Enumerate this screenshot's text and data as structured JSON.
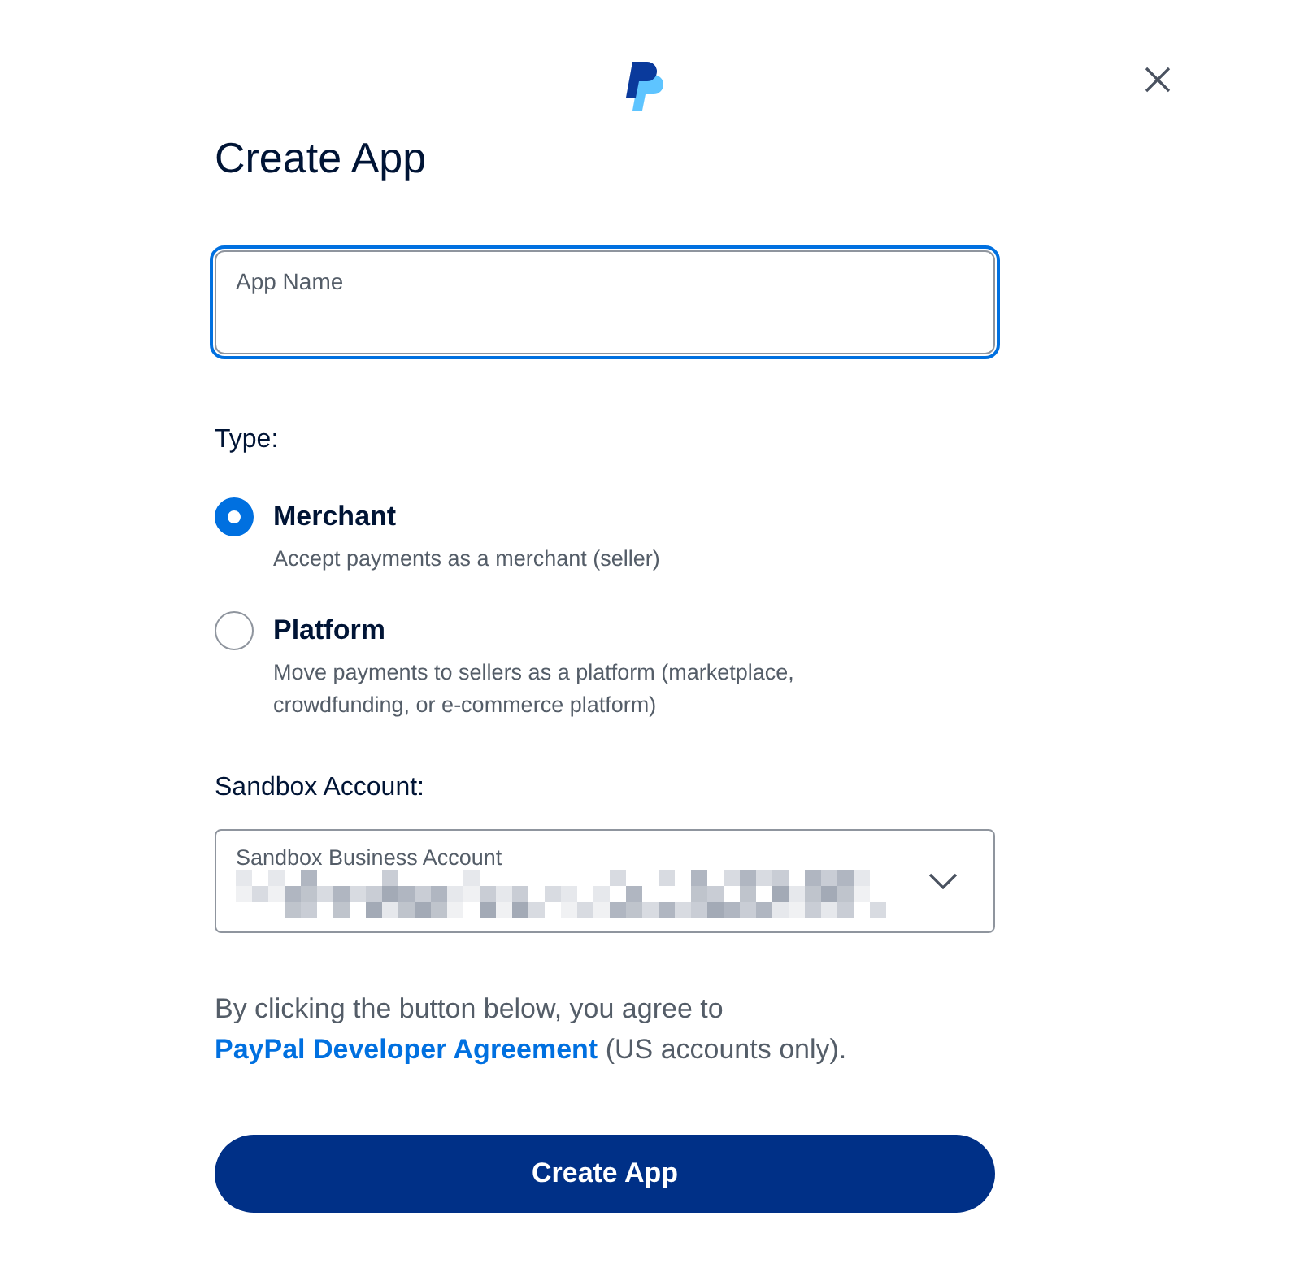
{
  "title": "Create App",
  "app_name_field": {
    "placeholder": "App Name",
    "focused": true
  },
  "type_label": "Type:",
  "types": [
    {
      "label": "Merchant",
      "description": "Accept payments as a merchant (seller)",
      "selected": true
    },
    {
      "label": "Platform",
      "description": "Move payments to sellers as a platform (marketplace, crowdfunding, or e-commerce platform)",
      "selected": false
    }
  ],
  "sandbox_label": "Sandbox Account:",
  "sandbox_select": {
    "label": "Sandbox Business Account"
  },
  "agreement": {
    "before": "By clicking the button below, you agree to",
    "link": "PayPal Developer Agreement",
    "after": "(US accounts only)."
  },
  "submit": "Create App"
}
